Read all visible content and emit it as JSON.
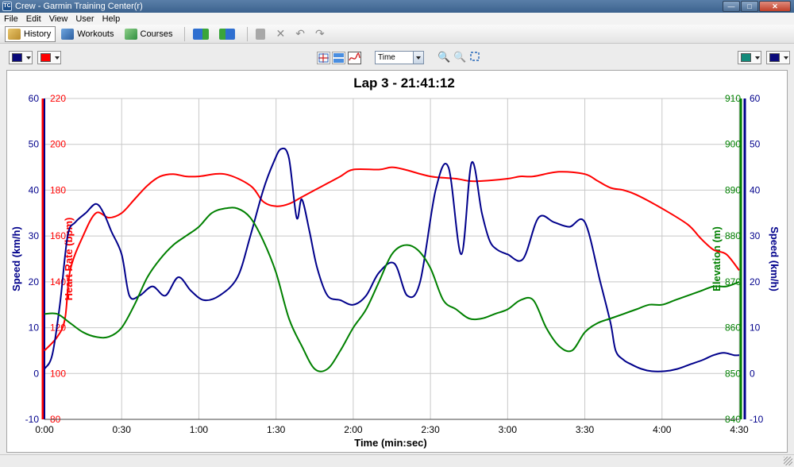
{
  "window": {
    "title": "Crew - Garmin Training Center(r)",
    "icon": "TC"
  },
  "menu": [
    "File",
    "Edit",
    "View",
    "User",
    "Help"
  ],
  "toolbar": {
    "tabs": [
      {
        "label": "History",
        "icon": "history-icon"
      },
      {
        "label": "Workouts",
        "icon": "workouts-icon"
      },
      {
        "label": "Courses",
        "icon": "courses-icon"
      }
    ]
  },
  "chart_toolbar": {
    "left_colors": [
      "#0a0a7a",
      "#ff0000"
    ],
    "right_colors": [
      "#138a7a",
      "#0a0a7a"
    ],
    "x_mode": "Time"
  },
  "chart_data": {
    "type": "line",
    "title": "Lap 3 - 21:41:12",
    "xlabel": "Time (min:sec)",
    "x_ticks": [
      "0:00",
      "0:30",
      "1:00",
      "1:30",
      "2:00",
      "2:30",
      "3:00",
      "3:30",
      "4:00",
      "4:30"
    ],
    "xlim": [
      0,
      270
    ],
    "grid": true,
    "axes": {
      "speed_left": {
        "label": "Speed (km/h)",
        "range": [
          -10,
          60
        ],
        "ticks": [
          "60",
          "50",
          "40",
          "30",
          "20",
          "10",
          "0",
          "-10"
        ],
        "color": "#00008b"
      },
      "heart_rate": {
        "label": "Heart Rate (bpm)",
        "range": [
          80,
          220
        ],
        "ticks": [
          "220",
          "200",
          "180",
          "160",
          "140",
          "120",
          "100",
          "80"
        ],
        "color": "#ff0000"
      },
      "elevation": {
        "label": "Elevation (m)",
        "range": [
          840,
          910
        ],
        "ticks": [
          "910",
          "900",
          "890",
          "880",
          "870",
          "860",
          "850",
          "840"
        ],
        "color": "#008000"
      },
      "speed_right": {
        "label": "Speed (km/h)",
        "range": [
          -10,
          60
        ],
        "ticks": [
          "60",
          "50",
          "40",
          "30",
          "20",
          "10",
          "0",
          "-10"
        ],
        "color": "#00008b"
      }
    },
    "series": [
      {
        "name": "Heart Rate",
        "axis": "heart_rate",
        "color": "#ff0000",
        "x": [
          0,
          5,
          8,
          10,
          15,
          20,
          25,
          30,
          35,
          40,
          45,
          50,
          55,
          60,
          70,
          80,
          85,
          90,
          95,
          100,
          105,
          110,
          115,
          120,
          130,
          135,
          140,
          150,
          160,
          165,
          170,
          180,
          185,
          190,
          200,
          210,
          215,
          220,
          225,
          230,
          240,
          250,
          255,
          260,
          265,
          270
        ],
        "y": [
          110,
          116,
          124,
          145,
          160,
          170,
          168,
          170,
          176,
          182,
          186,
          187,
          186,
          186,
          187,
          182,
          175,
          173,
          174,
          177,
          180,
          183,
          186,
          189,
          189,
          190,
          189,
          186,
          185,
          184,
          184,
          185,
          186,
          186,
          188,
          187,
          184,
          181,
          180,
          178,
          172,
          165,
          159,
          154,
          152,
          145
        ]
      },
      {
        "name": "Speed",
        "axis": "speed_left",
        "color": "#00008b",
        "x": [
          0,
          3,
          6,
          9,
          12,
          16,
          20,
          23,
          26,
          30,
          33,
          37,
          42,
          47,
          52,
          57,
          62,
          68,
          75,
          80,
          85,
          89,
          92,
          95,
          98,
          100,
          103,
          106,
          110,
          115,
          120,
          125,
          130,
          136,
          141,
          146,
          152,
          157,
          162,
          166,
          170,
          173,
          176,
          180,
          186,
          192,
          198,
          204,
          210,
          216,
          220,
          222,
          225,
          228,
          232,
          236,
          241,
          246,
          251,
          256,
          260,
          264,
          268,
          270
        ],
        "y": [
          1,
          4,
          15,
          30,
          33,
          35,
          37,
          35,
          31,
          26,
          17,
          17,
          19,
          17,
          21,
          18,
          16,
          17,
          21,
          30,
          40,
          46,
          49,
          47,
          34,
          38,
          31,
          23,
          17,
          16,
          15,
          17,
          22,
          24,
          17,
          20,
          40,
          45,
          26,
          46,
          35,
          29,
          27,
          26,
          25,
          34,
          33,
          32,
          33,
          20,
          11,
          5,
          3,
          2,
          1,
          0.5,
          0.5,
          1,
          2,
          3,
          4,
          4.5,
          4,
          4
        ]
      },
      {
        "name": "Elevation",
        "axis": "elevation",
        "color": "#008000",
        "x": [
          0,
          5,
          10,
          15,
          20,
          25,
          30,
          35,
          40,
          45,
          50,
          55,
          60,
          65,
          70,
          75,
          80,
          85,
          90,
          95,
          100,
          105,
          110,
          115,
          120,
          125,
          130,
          135,
          140,
          145,
          150,
          155,
          160,
          165,
          170,
          175,
          180,
          185,
          190,
          195,
          200,
          205,
          210,
          215,
          220,
          225,
          230,
          235,
          240,
          245,
          250,
          255,
          260,
          265,
          270
        ],
        "y": [
          863,
          863,
          861,
          859,
          858,
          858,
          860,
          865,
          871,
          875,
          878,
          880,
          882,
          885,
          886,
          886,
          884,
          879,
          872,
          862,
          856,
          851,
          851,
          855,
          860,
          864,
          870,
          876,
          878,
          877,
          873,
          866,
          864,
          862,
          862,
          863,
          864,
          866,
          866,
          860,
          856,
          855,
          859,
          861,
          862,
          863,
          864,
          865,
          865,
          866,
          867,
          868,
          869,
          869,
          870
        ]
      }
    ]
  }
}
